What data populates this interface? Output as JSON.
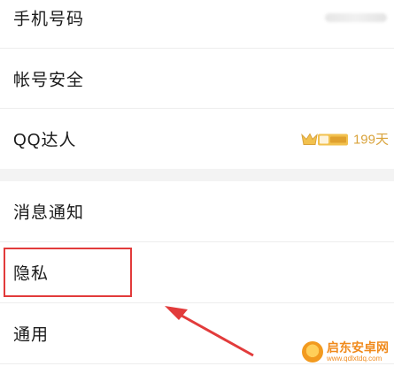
{
  "settings": {
    "items": [
      {
        "label": "手机号码"
      },
      {
        "label": "帐号安全"
      },
      {
        "label": "QQ达人",
        "badge_days": "199天"
      },
      {
        "label": "消息通知"
      },
      {
        "label": "隐私"
      },
      {
        "label": "通用"
      }
    ]
  },
  "watermark": {
    "title": "启东安卓网",
    "url": "www.qdlxtdq.com"
  },
  "colors": {
    "highlight": "#e23b3b",
    "badge_gold": "#d9a33b",
    "watermark": "#f08a1c"
  }
}
